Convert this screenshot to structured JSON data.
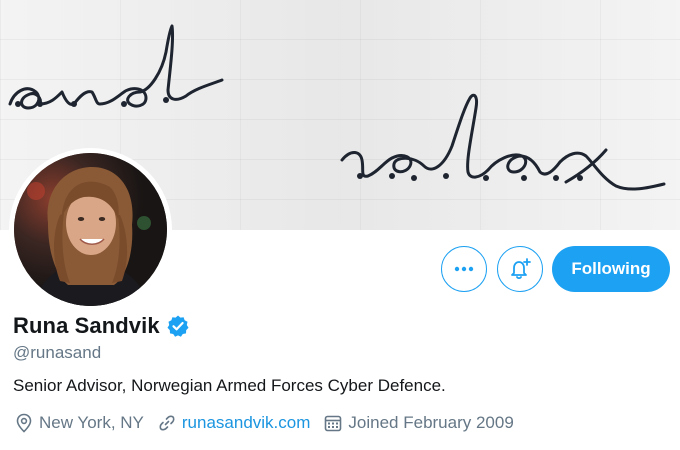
{
  "banner": {
    "script_line_1": "and",
    "script_line_2": "relax"
  },
  "profile": {
    "name": "Runa Sandvik",
    "handle": "@runasand",
    "bio": "Senior Advisor, Norwegian Armed Forces Cyber Defence.",
    "verified": true
  },
  "actions": {
    "more_icon": "more-icon",
    "notify_icon": "bell-plus-icon",
    "follow_label": "Following"
  },
  "meta": {
    "location": "New York, NY",
    "website": "runasandvik.com",
    "joined": "Joined February 2009",
    "location_icon": "location-pin-icon",
    "link_icon": "link-icon",
    "calendar_icon": "calendar-icon"
  },
  "colors": {
    "accent": "#1da1f2",
    "muted_text": "#657786",
    "link": "#1b95e0",
    "text": "#14171a"
  }
}
